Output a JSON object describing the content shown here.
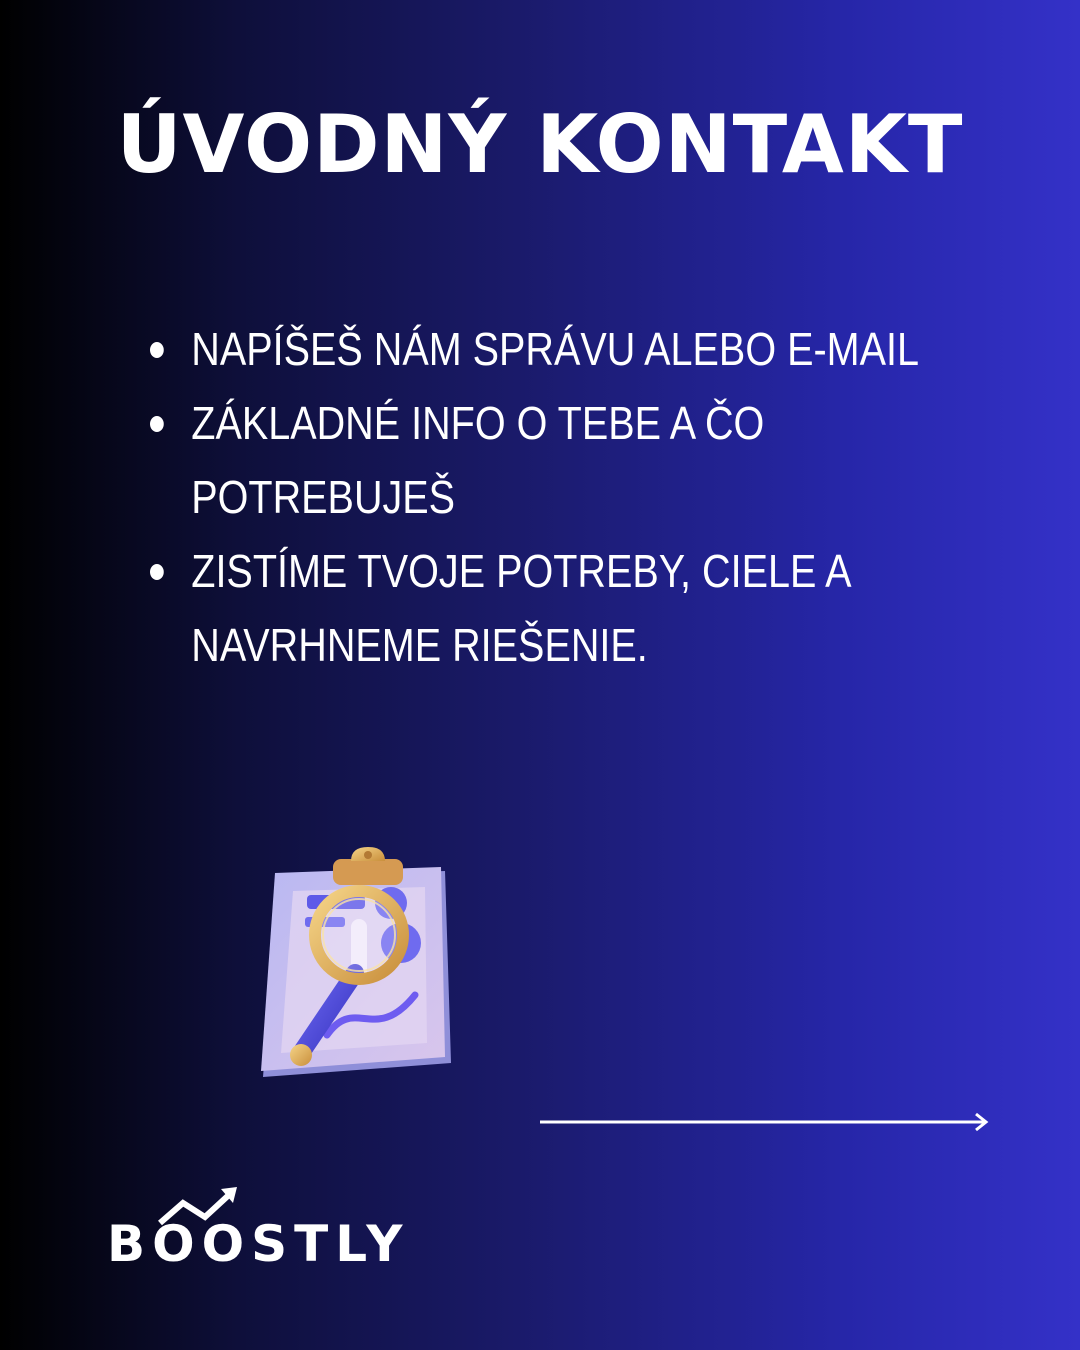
{
  "title": "ÚVODNÝ KONTAKT",
  "bullets": [
    "NAPÍŠEŠ NÁM SPRÁVU ALEBO E-MAIL",
    "ZÁKLADNÉ INFO O TEBE A ČO POTREBUJEŠ",
    "ZISTÍME TVOJE POTREBY, CIELE A NAVRHNEME RIEŠENIE."
  ],
  "illustration_icon": "clipboard-magnifier-icon",
  "arrow_icon": "arrow-right-icon",
  "logo": {
    "text": "BOOSTLY",
    "icon": "growth-arrow-icon"
  },
  "colors": {
    "background_start": "#000000",
    "background_end": "#3431c8",
    "text": "#ffffff",
    "clipboard": "#c9c6f0",
    "magnifier_gold": "#e7b865",
    "magnifier_handle": "#4a46d8"
  }
}
